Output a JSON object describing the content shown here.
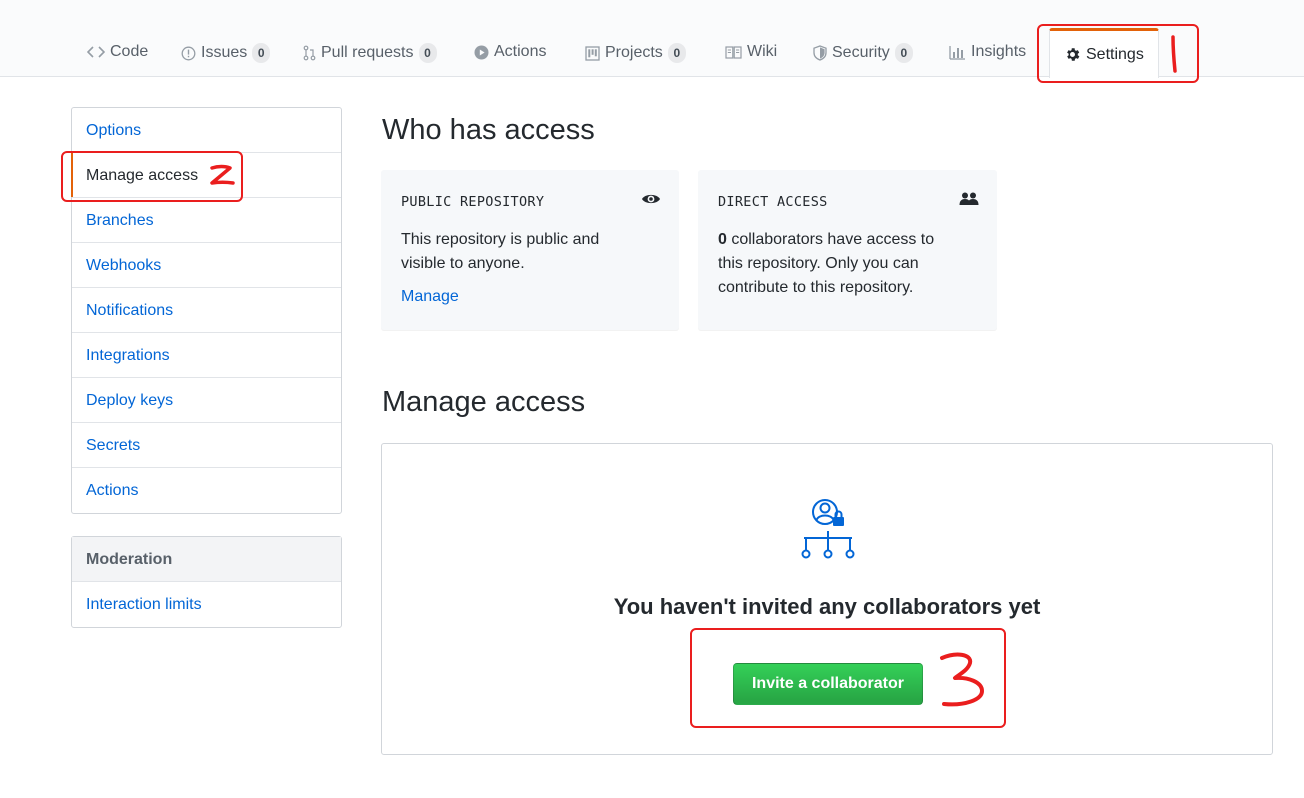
{
  "nav": {
    "tabs": [
      {
        "label": "Code",
        "icon": "code-icon"
      },
      {
        "label": "Issues",
        "icon": "issue-icon",
        "count": "0"
      },
      {
        "label": "Pull requests",
        "icon": "pull-request-icon",
        "count": "0"
      },
      {
        "label": "Actions",
        "icon": "play-icon"
      },
      {
        "label": "Projects",
        "icon": "project-icon",
        "count": "0"
      },
      {
        "label": "Wiki",
        "icon": "book-icon"
      },
      {
        "label": "Security",
        "icon": "shield-icon",
        "count": "0"
      },
      {
        "label": "Insights",
        "icon": "graph-icon"
      },
      {
        "label": "Settings",
        "icon": "gear-icon",
        "selected": true
      }
    ]
  },
  "sidebar": {
    "items": [
      {
        "label": "Options"
      },
      {
        "label": "Manage access",
        "selected": true
      },
      {
        "label": "Branches"
      },
      {
        "label": "Webhooks"
      },
      {
        "label": "Notifications"
      },
      {
        "label": "Integrations"
      },
      {
        "label": "Deploy keys"
      },
      {
        "label": "Secrets"
      },
      {
        "label": "Actions"
      }
    ],
    "moderation": {
      "heading": "Moderation",
      "items": [
        {
          "label": "Interaction limits"
        }
      ]
    }
  },
  "main": {
    "who_title": "Who has access",
    "public_box": {
      "title": "PUBLIC REPOSITORY",
      "text": "This repository is public and visible to anyone.",
      "link": "Manage",
      "icon": "eye-icon"
    },
    "direct_box": {
      "title": "DIRECT ACCESS",
      "count": "0",
      "text": " collaborators have access to this repository. Only you can contribute to this repository.",
      "icon": "people-icon"
    },
    "manage_title": "Manage access",
    "blank": {
      "icon": "collaborators-lock-icon",
      "title": "You haven't invited any collaborators yet",
      "button": "Invite a collaborator"
    }
  },
  "colors": {
    "accent": "#e36209",
    "link": "#0366d6",
    "button": "#28a745",
    "annotation": "#ea1e1e"
  }
}
